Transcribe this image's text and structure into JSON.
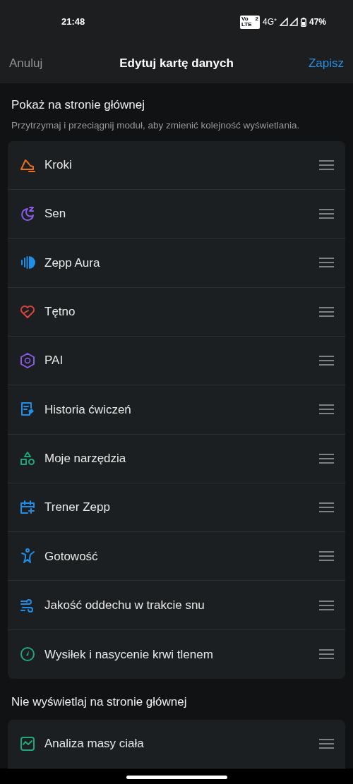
{
  "status_bar": {
    "time": "21:48",
    "volte_top": "Vo",
    "volte_sim": "2",
    "volte_bottom": "LTE",
    "network": "4G⁺",
    "battery": "47%"
  },
  "header": {
    "cancel": "Anuluj",
    "title": "Edytuj kartę danych",
    "save": "Zapisz"
  },
  "shown_section": {
    "title": "Pokaż na stronie głównej",
    "hint": "Przytrzymaj i przeciągnij moduł, aby zmienić kolejność wyświetlania.",
    "items": [
      {
        "label": "Kroki",
        "kind": "shoe",
        "color": "#e8701e"
      },
      {
        "label": "Sen",
        "kind": "moon",
        "color": "#8a5ce6"
      },
      {
        "label": "Zepp Aura",
        "kind": "aura",
        "color": "#1e8ee8"
      },
      {
        "label": "Tętno",
        "kind": "heart",
        "color": "#e0443c"
      },
      {
        "label": "PAI",
        "kind": "pai",
        "color": "#8a5ce6"
      },
      {
        "label": "Historia ćwiczeń",
        "kind": "document",
        "color": "#1e8ee8"
      },
      {
        "label": "Moje narzędzia",
        "kind": "shapes",
        "color": "#22a67a"
      },
      {
        "label": "Trener Zepp",
        "kind": "calendar",
        "color": "#1e8ee8"
      },
      {
        "label": "Gotowość",
        "kind": "figure",
        "color": "#1e8ee8"
      },
      {
        "label": "Jakość oddechu w trakcie snu",
        "kind": "wind",
        "color": "#1e8ee8"
      },
      {
        "label": "Wysiłek i nasycenie krwi tlenem",
        "kind": "drop",
        "color": "#22a67a"
      }
    ]
  },
  "hidden_section": {
    "title": "Nie wyświetlaj na stronie głównej",
    "items": [
      {
        "label": "Analiza masy ciała",
        "kind": "chart",
        "color": "#22a67a"
      }
    ]
  }
}
